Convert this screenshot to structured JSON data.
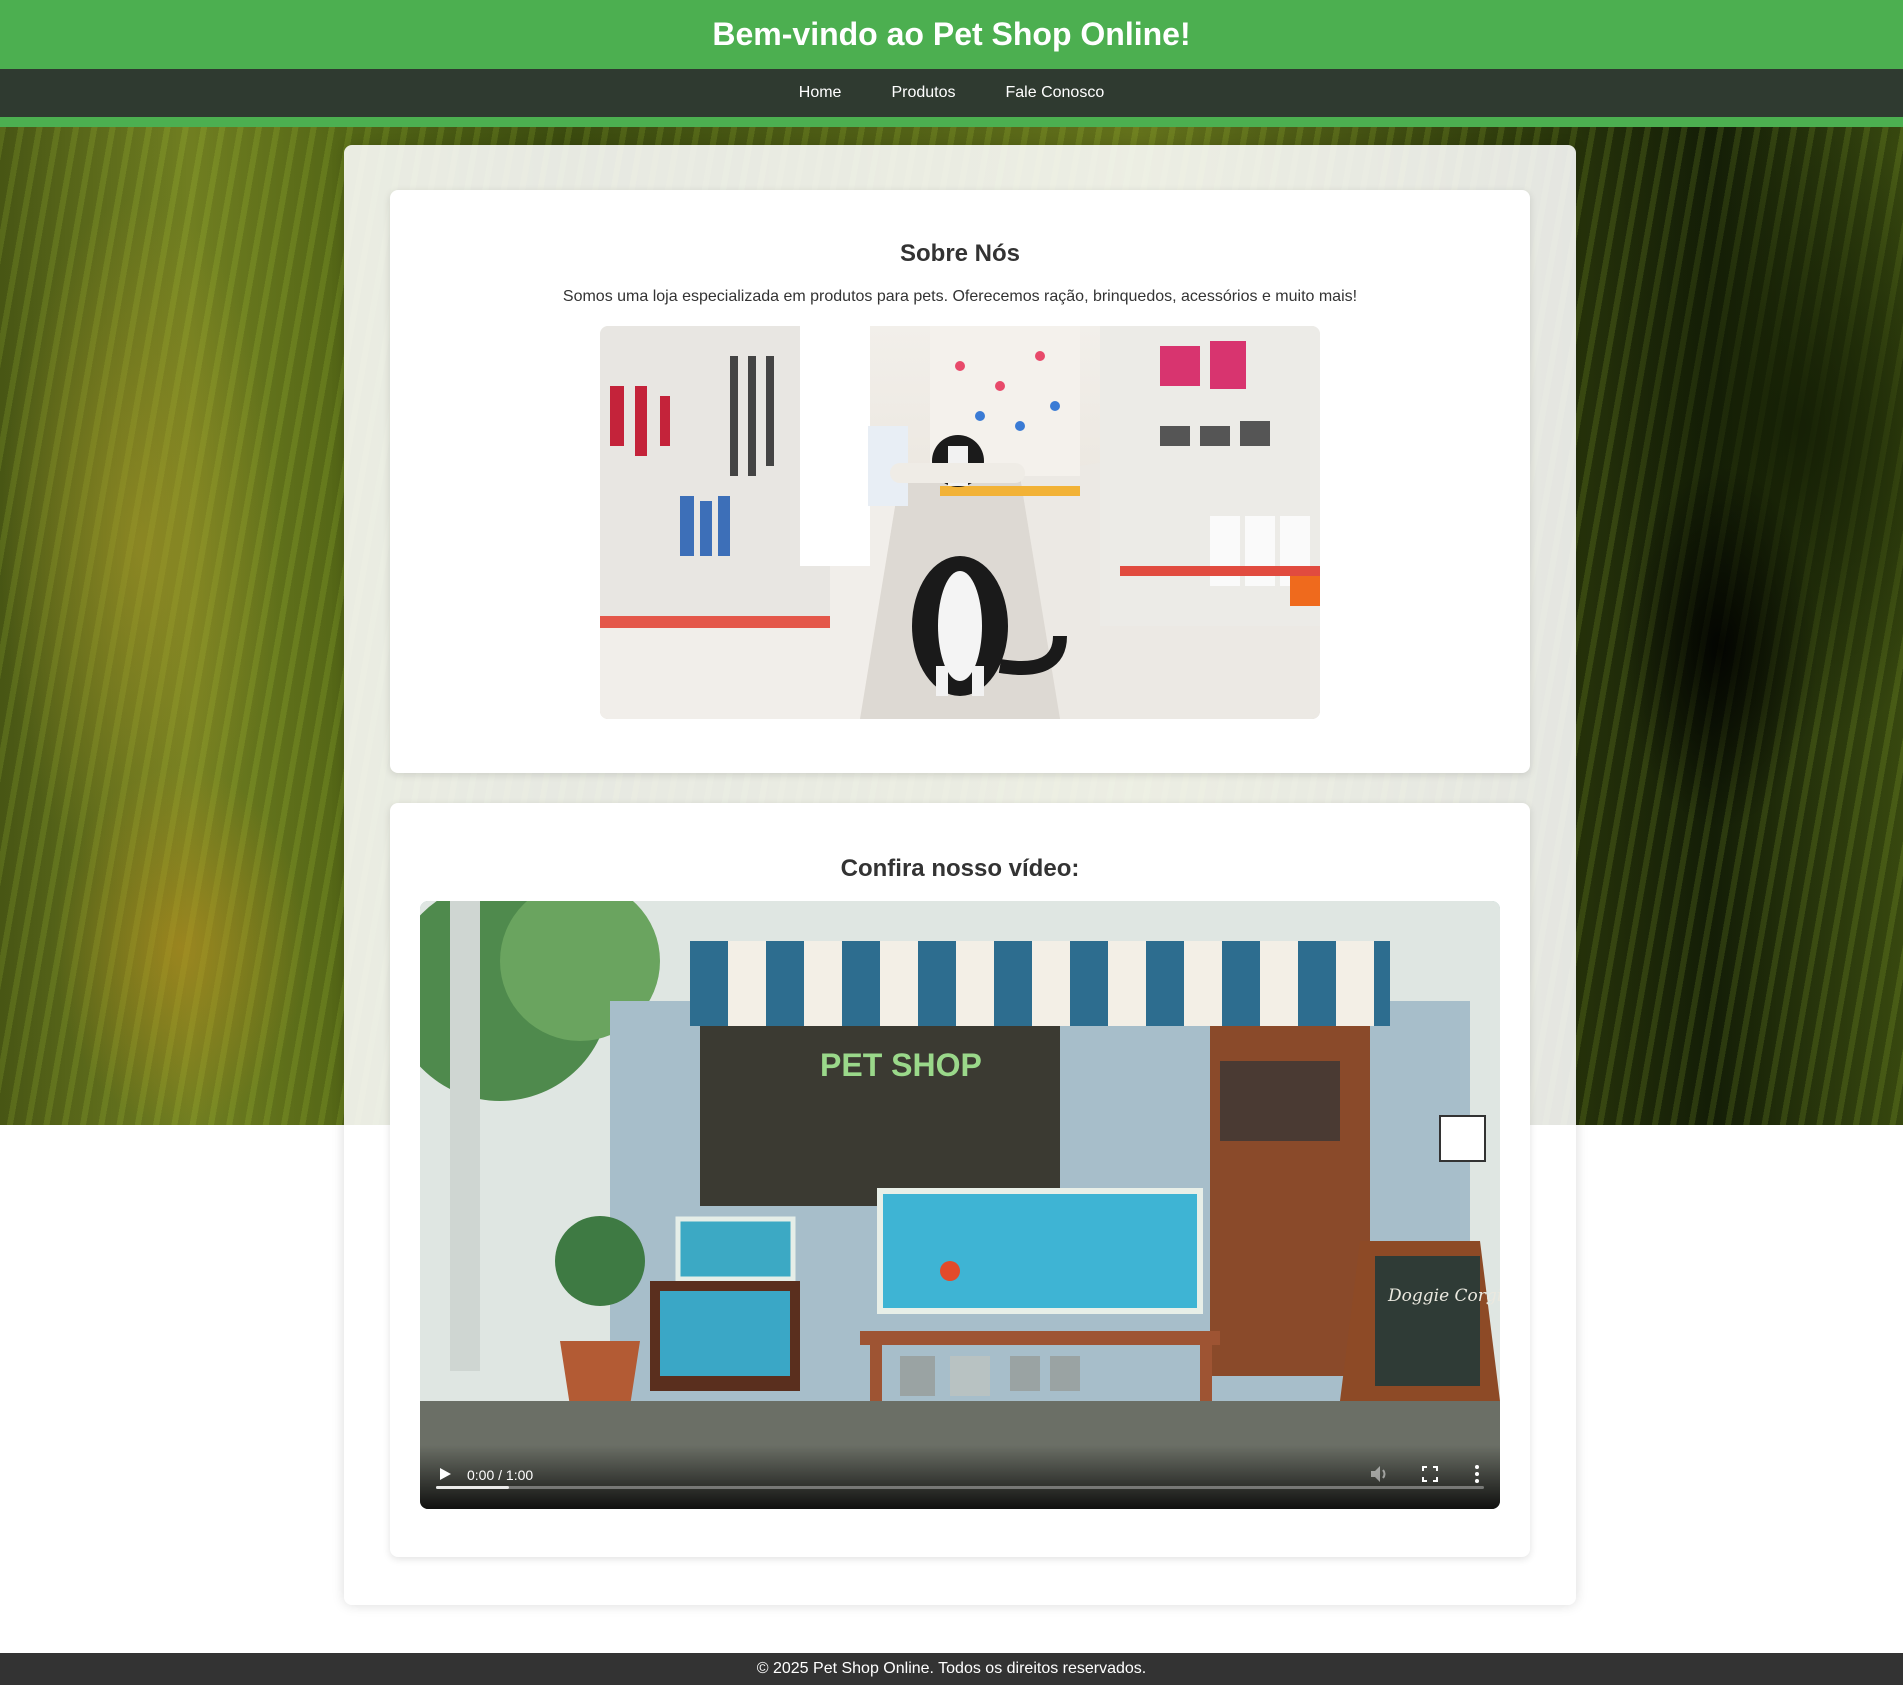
{
  "header": {
    "title": "Bem-vindo ao Pet Shop Online!"
  },
  "nav": {
    "items": [
      {
        "label": "Home"
      },
      {
        "label": "Produtos"
      },
      {
        "label": "Fale Conosco"
      }
    ]
  },
  "about": {
    "title": "Sobre Nós",
    "text": "Somos uma loja especializada em produtos para pets. Oferecemos ração, brinquedos, acessórios e muito mais!"
  },
  "video": {
    "title": "Confira nosso vídeo:",
    "time": "0:00 / 1:00",
    "progress_fraction": 0.07,
    "sign_text": "PET SHOP",
    "board_text": "Doggie Corgi"
  },
  "footer": {
    "text": "© 2025 Pet Shop Online. Todos os direitos reservados."
  },
  "colors": {
    "header": "#4caf50",
    "nav": "#2f3a30",
    "footer": "#333333"
  }
}
